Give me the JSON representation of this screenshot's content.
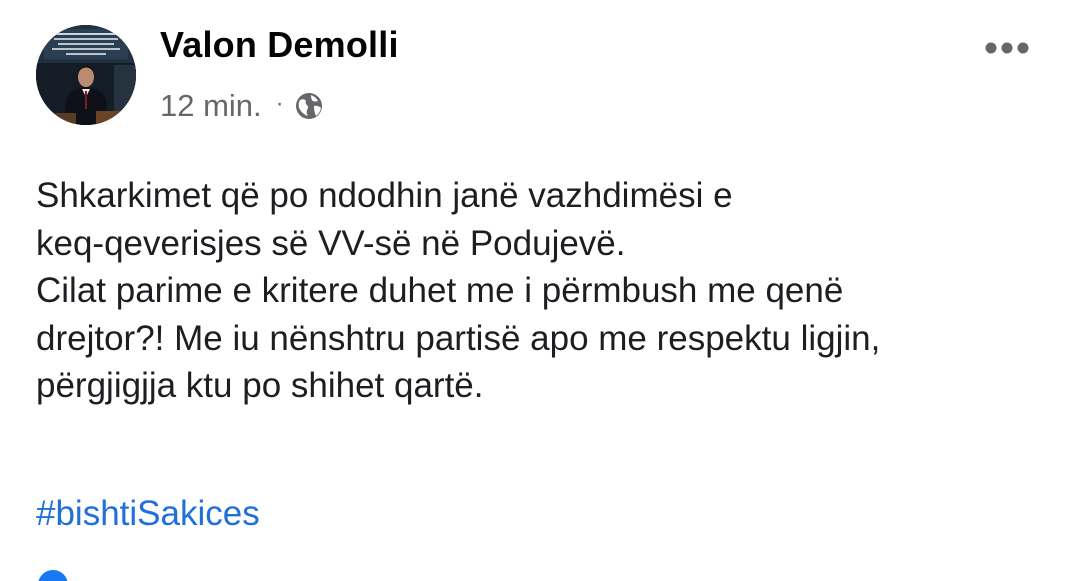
{
  "post": {
    "author": "Valon Demolli",
    "time": "12 min.",
    "separator": "·",
    "privacy_icon": "globe-icon",
    "more_icon": "more-options-icon",
    "body_lines": [
      "Shkarkimet që po ndodhin janë vazhdimësi e",
      "keq-qeverisjes së VV-së në Podujevë.",
      "Cilat parime e kritere duhet me i përmbush me qenë",
      "drejtor?! Me iu nënshtru partisë apo me respektu ligjin,",
      "përgjigjja ktu po shihet qartë."
    ],
    "hashtag": "#bishtiSakices"
  },
  "colors": {
    "author": "#050505",
    "meta": "#65676b",
    "body": "#1c1e21",
    "hashtag": "#216fdb",
    "reaction": "#1877f2"
  }
}
